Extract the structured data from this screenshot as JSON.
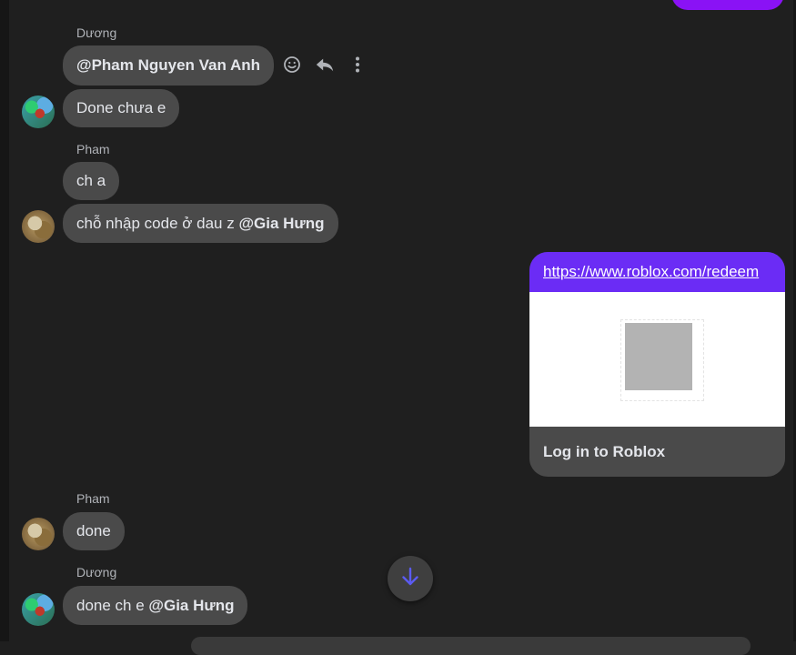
{
  "messages": [
    {
      "sender": "Dương",
      "text": "@Pham Nguyen Van Anh",
      "avatar_icon": "user-avatar-duong"
    },
    {
      "text": "Done chưa e"
    },
    {
      "sender": "Pham",
      "text": "ch a"
    },
    {
      "text_prefix": "chỗ nhập code ở dau z ",
      "mention": "@Gia Hưng"
    },
    {
      "sender": "Pham",
      "text": "done"
    },
    {
      "sender": "Dương",
      "text_prefix": "done ch e ",
      "mention": "@Gia Hưng"
    }
  ],
  "link_card": {
    "url": "https://www.roblox.com/redeem",
    "title": "Log in to Roblox",
    "accent_color": "#6b2cf5"
  },
  "colors": {
    "background": "#1f1f1f",
    "incoming_bubble": "#4a4a4a",
    "outgoing_bubble": "#8a12f5",
    "scroll_arrow": "#5b5bf0"
  },
  "icons": [
    "emoji-icon",
    "reply-icon",
    "more-options-icon",
    "arrow-down-icon"
  ]
}
